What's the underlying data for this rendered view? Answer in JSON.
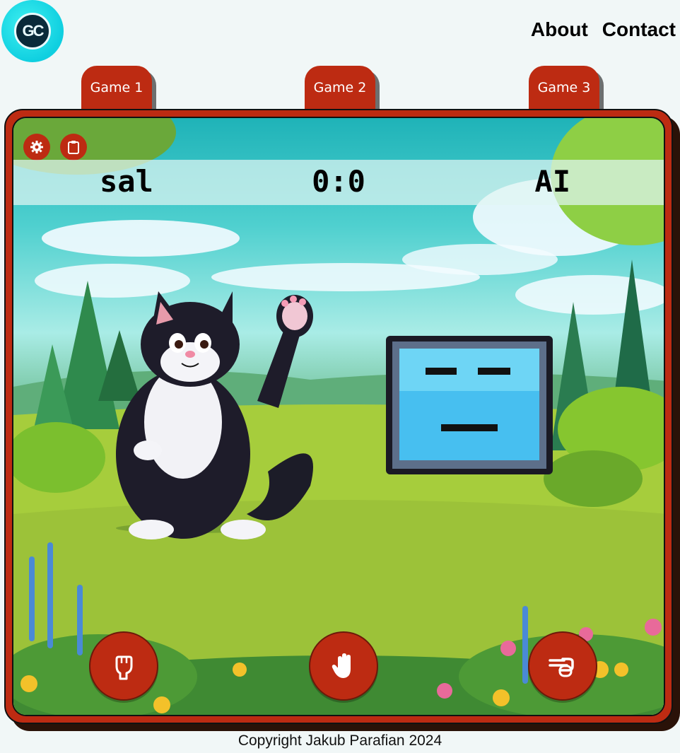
{
  "logo": {
    "text": "GC"
  },
  "nav": {
    "about": "About",
    "contact": "Contact"
  },
  "tabs": [
    "Game 1",
    "Game 2",
    "Game 3"
  ],
  "scoreboard": {
    "player": "sal",
    "score": "0:0",
    "opponent": "AI"
  },
  "controls": {
    "settings_icon": "gear-icon",
    "clipboard_icon": "clipboard-icon",
    "choices": [
      {
        "icon": "fist-rock-icon"
      },
      {
        "icon": "open-hand-paper-icon"
      },
      {
        "icon": "scissors-hand-icon"
      }
    ]
  },
  "footer": {
    "copyright": "Copyright Jakub Parafian 2024"
  },
  "colors": {
    "accent": "#bd2b12",
    "background": "#f1f7f7"
  }
}
